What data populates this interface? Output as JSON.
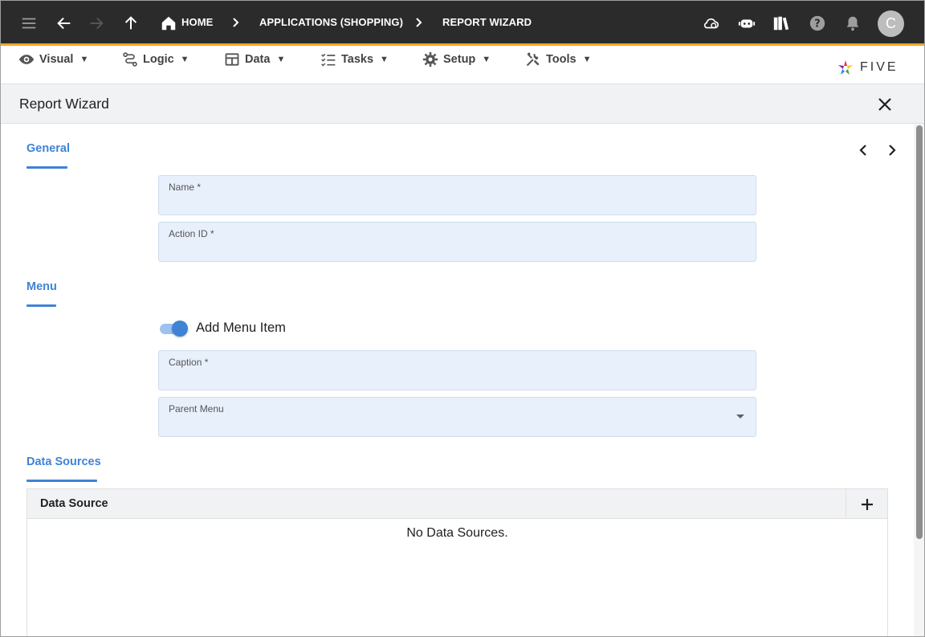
{
  "topbar": {
    "breadcrumbs": [
      {
        "label": "HOME"
      },
      {
        "label": "APPLICATIONS (SHOPPING)"
      },
      {
        "label": "REPORT WIZARD"
      }
    ],
    "avatar_initial": "C",
    "bar_color": "#2b2b2b",
    "accent_color": "#f5a623"
  },
  "menubar": {
    "items": [
      {
        "label": "Visual",
        "icon": "eye-icon"
      },
      {
        "label": "Logic",
        "icon": "logic-icon"
      },
      {
        "label": "Data",
        "icon": "table-icon"
      },
      {
        "label": "Tasks",
        "icon": "tasks-icon"
      },
      {
        "label": "Setup",
        "icon": "gear-icon"
      },
      {
        "label": "Tools",
        "icon": "tools-icon"
      }
    ],
    "logo_text": "FIVE"
  },
  "page": {
    "title": "Report Wizard"
  },
  "sections": {
    "general": {
      "label": "General"
    },
    "menu": {
      "label": "Menu"
    },
    "data_sources": {
      "label": "Data Sources"
    }
  },
  "fields": {
    "name": {
      "label": "Name *",
      "value": ""
    },
    "action_id": {
      "label": "Action ID *",
      "value": ""
    },
    "caption": {
      "label": "Caption *",
      "value": ""
    },
    "parent_menu": {
      "label": "Parent Menu",
      "value": ""
    }
  },
  "toggle": {
    "label": "Add Menu Item",
    "checked": true
  },
  "data_source_table": {
    "column": "Data Source",
    "empty_message": "No Data Sources."
  },
  "colors": {
    "accent_blue": "#3f83d6",
    "field_bg": "#e8f0fc"
  }
}
